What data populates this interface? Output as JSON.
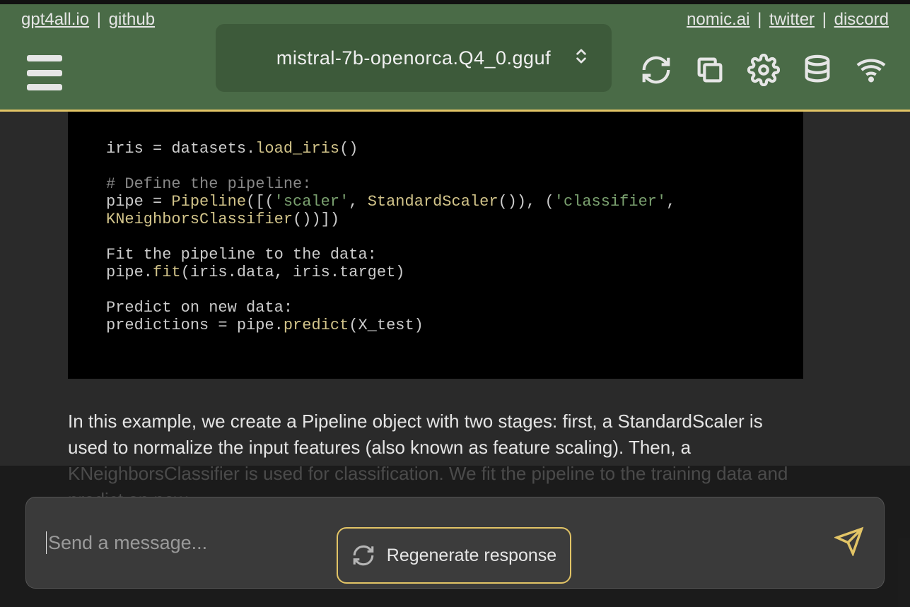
{
  "links": {
    "left": [
      "gpt4all.io",
      "github"
    ],
    "right": [
      "nomic.ai",
      "twitter",
      "discord"
    ],
    "sep": " | "
  },
  "model": {
    "selected": "mistral-7b-openorca.Q4_0.gguf"
  },
  "code": {
    "lines": [
      {
        "tokens": [
          [
            "plain",
            "iris = datasets."
          ],
          [
            "func",
            "load_iris"
          ],
          [
            "plain",
            "()"
          ]
        ]
      },
      {
        "tokens": []
      },
      {
        "tokens": [
          [
            "comment",
            "# Define the pipeline:"
          ]
        ]
      },
      {
        "tokens": [
          [
            "plain",
            "pipe = "
          ],
          [
            "func",
            "Pipeline"
          ],
          [
            "plain",
            "([("
          ],
          [
            "string",
            "'scaler'"
          ],
          [
            "plain",
            ", "
          ],
          [
            "func",
            "StandardScaler"
          ],
          [
            "plain",
            "()), ("
          ],
          [
            "string",
            "'classifier'"
          ],
          [
            "plain",
            ", "
          ]
        ]
      },
      {
        "tokens": [
          [
            "func",
            "KNeighborsClassifier"
          ],
          [
            "plain",
            "())])"
          ]
        ]
      },
      {
        "tokens": []
      },
      {
        "tokens": [
          [
            "plain",
            "Fit the pipeline to the data:"
          ]
        ]
      },
      {
        "tokens": [
          [
            "plain",
            "pipe."
          ],
          [
            "func",
            "fit"
          ],
          [
            "plain",
            "(iris.data, iris.target)"
          ]
        ]
      },
      {
        "tokens": []
      },
      {
        "tokens": [
          [
            "plain",
            "Predict on new data:"
          ]
        ]
      },
      {
        "tokens": [
          [
            "plain",
            "predictions = pipe."
          ],
          [
            "func",
            "predict"
          ],
          [
            "plain",
            "(X_test)"
          ]
        ]
      }
    ]
  },
  "explanation": "In this example, we create a Pipeline object with two stages: first, a StandardScaler is used to normalize the input features (also known as feature scaling). Then, a KNeighborsClassifier is used for classification. We fit the pipeline to the training data and predict on new",
  "regen_label": "Regenerate response",
  "input": {
    "placeholder": "Send a message...",
    "value": ""
  },
  "icons": {
    "menu": "menu-icon",
    "reload": "reload-icon",
    "copy": "copy-icon",
    "settings": "gear-icon",
    "database": "database-icon",
    "wifi": "wifi-icon",
    "send": "send-icon",
    "updown": "chevron-updown-icon",
    "regen": "regenerate-icon"
  }
}
